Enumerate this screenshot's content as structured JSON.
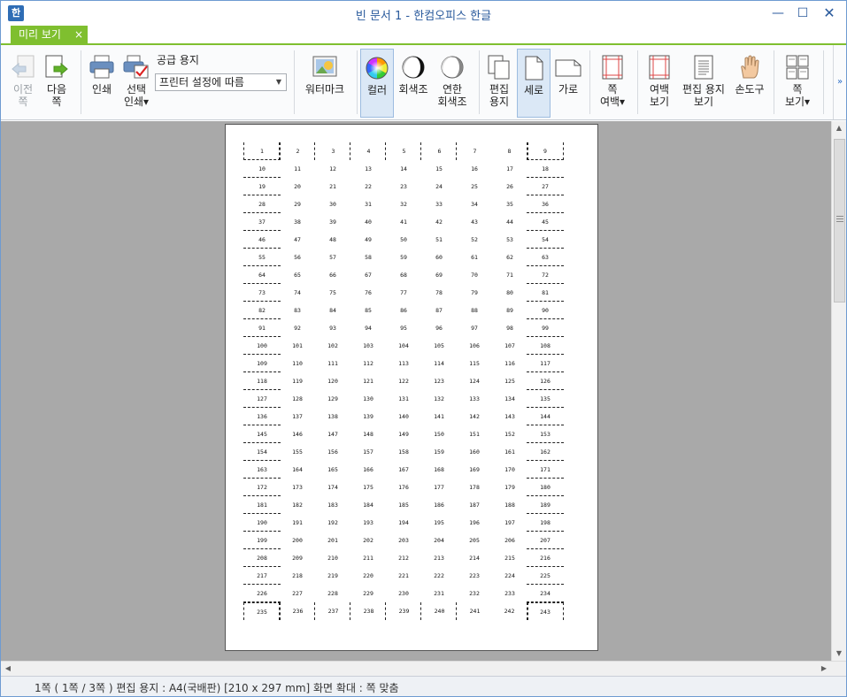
{
  "window": {
    "title": "빈 문서 1 - 한컴오피스 한글",
    "app_icon_glyph": "한",
    "minimize_glyph": "—",
    "maximize_glyph": "☐",
    "close_glyph": "✕"
  },
  "tab": {
    "label": "미리 보기",
    "close_glyph": "×",
    "accent_color": "#7fbf2f"
  },
  "ribbon": {
    "prev_page": [
      "이전",
      "쪽"
    ],
    "next_page": [
      "다음",
      "쪽"
    ],
    "print": "인쇄",
    "select_print": [
      "선택",
      "인쇄▾"
    ],
    "paper_label": "공급 용지",
    "paper_value": "프린터 설정에 따름",
    "watermark": "워터마크",
    "color": "컬러",
    "grayscale": "회색조",
    "light_grayscale": [
      "연한",
      "회색조"
    ],
    "edit_paper": [
      "편집",
      "용지"
    ],
    "portrait": "세로",
    "landscape": "가로",
    "page_margin": [
      "쪽",
      "여백▾"
    ],
    "margin_view": [
      "여백",
      "보기"
    ],
    "edit_paper_view": [
      "편집 용지",
      "보기"
    ],
    "hand_tool": "손도구",
    "page_view": [
      "쪽",
      "보기▾"
    ],
    "expand_glyph": "»"
  },
  "document": {
    "rows": [
      [
        "1",
        "2",
        "3",
        "4",
        "5",
        "6",
        "7",
        "8",
        "9"
      ],
      [
        "10",
        "11",
        "12",
        "13",
        "14",
        "15",
        "16",
        "17",
        "18"
      ],
      [
        "19",
        "20",
        "21",
        "22",
        "23",
        "24",
        "25",
        "26",
        "27"
      ],
      [
        "28",
        "29",
        "30",
        "31",
        "32",
        "33",
        "34",
        "35",
        "36"
      ],
      [
        "37",
        "38",
        "39",
        "40",
        "41",
        "42",
        "43",
        "44",
        "45"
      ],
      [
        "46",
        "47",
        "48",
        "49",
        "50",
        "51",
        "52",
        "53",
        "54"
      ],
      [
        "55",
        "56",
        "57",
        "58",
        "59",
        "60",
        "61",
        "62",
        "63"
      ],
      [
        "64",
        "65",
        "66",
        "67",
        "68",
        "69",
        "70",
        "71",
        "72"
      ],
      [
        "73",
        "74",
        "75",
        "76",
        "77",
        "78",
        "79",
        "80",
        "81"
      ],
      [
        "82",
        "83",
        "84",
        "85",
        "86",
        "87",
        "88",
        "89",
        "90"
      ],
      [
        "91",
        "92",
        "93",
        "94",
        "95",
        "96",
        "97",
        "98",
        "99"
      ],
      [
        "100",
        "101",
        "102",
        "103",
        "104",
        "105",
        "106",
        "107",
        "108"
      ],
      [
        "109",
        "110",
        "111",
        "112",
        "113",
        "114",
        "115",
        "116",
        "117"
      ],
      [
        "118",
        "119",
        "120",
        "121",
        "122",
        "123",
        "124",
        "125",
        "126"
      ],
      [
        "127",
        "128",
        "129",
        "130",
        "131",
        "132",
        "133",
        "134",
        "135"
      ],
      [
        "136",
        "137",
        "138",
        "139",
        "140",
        "141",
        "142",
        "143",
        "144"
      ],
      [
        "145",
        "146",
        "147",
        "148",
        "149",
        "150",
        "151",
        "152",
        "153"
      ],
      [
        "154",
        "155",
        "156",
        "157",
        "158",
        "159",
        "160",
        "161",
        "162"
      ],
      [
        "163",
        "164",
        "165",
        "166",
        "167",
        "168",
        "169",
        "170",
        "171"
      ],
      [
        "172",
        "173",
        "174",
        "175",
        "176",
        "177",
        "178",
        "179",
        "180"
      ],
      [
        "181",
        "182",
        "183",
        "184",
        "185",
        "186",
        "187",
        "188",
        "189"
      ],
      [
        "190",
        "191",
        "192",
        "193",
        "194",
        "195",
        "196",
        "197",
        "198"
      ],
      [
        "199",
        "200",
        "201",
        "202",
        "203",
        "204",
        "205",
        "206",
        "207"
      ],
      [
        "208",
        "209",
        "210",
        "211",
        "212",
        "213",
        "214",
        "215",
        "216"
      ],
      [
        "217",
        "218",
        "219",
        "220",
        "221",
        "222",
        "223",
        "224",
        "225"
      ],
      [
        "226",
        "227",
        "228",
        "229",
        "230",
        "231",
        "232",
        "233",
        "234"
      ],
      [
        "235",
        "236",
        "237",
        "238",
        "239",
        "240",
        "241",
        "242",
        "243"
      ]
    ]
  },
  "scrollbars": {
    "up": "▲",
    "down": "▼",
    "left": "◀",
    "right": "▶"
  },
  "status": {
    "text": "1쪽 ( 1쪽 / 3쪽 ) 편집 용지 : A4(국배판) [210 x 297 mm] 화면 확대 : 쪽 맞춤"
  }
}
